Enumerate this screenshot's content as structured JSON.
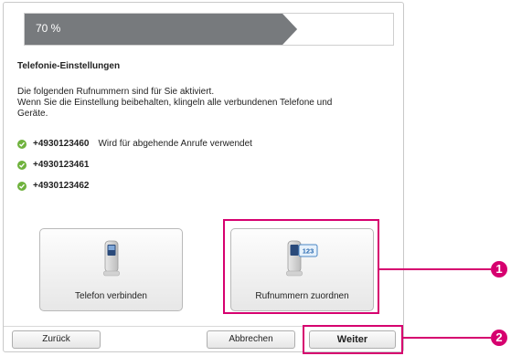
{
  "progress": {
    "label": "70 %",
    "value_percent": 70
  },
  "section_title": "Telefonie-Einstellungen",
  "intro_lines": [
    "Die folgenden Rufnummern sind für Sie aktiviert.",
    "Wenn Sie die Einstellung beibehalten, klingeln alle verbundenen Telefone und",
    "Geräte."
  ],
  "numbers": [
    {
      "number": "+4930123460",
      "note": "Wird für abgehende Anrufe verwendet"
    },
    {
      "number": "+4930123461",
      "note": ""
    },
    {
      "number": "+4930123462",
      "note": ""
    }
  ],
  "actions": {
    "connect_phone": "Telefon verbinden",
    "assign_numbers": "Rufnummern zuordnen",
    "assign_badge": "123"
  },
  "footer": {
    "back": "Zurück",
    "cancel": "Abbrechen",
    "next": "Weiter"
  },
  "callouts": [
    "1",
    "2"
  ],
  "colors": {
    "accent": "#d6006f",
    "check": "#6fb23d",
    "progress": "#777a7d"
  }
}
